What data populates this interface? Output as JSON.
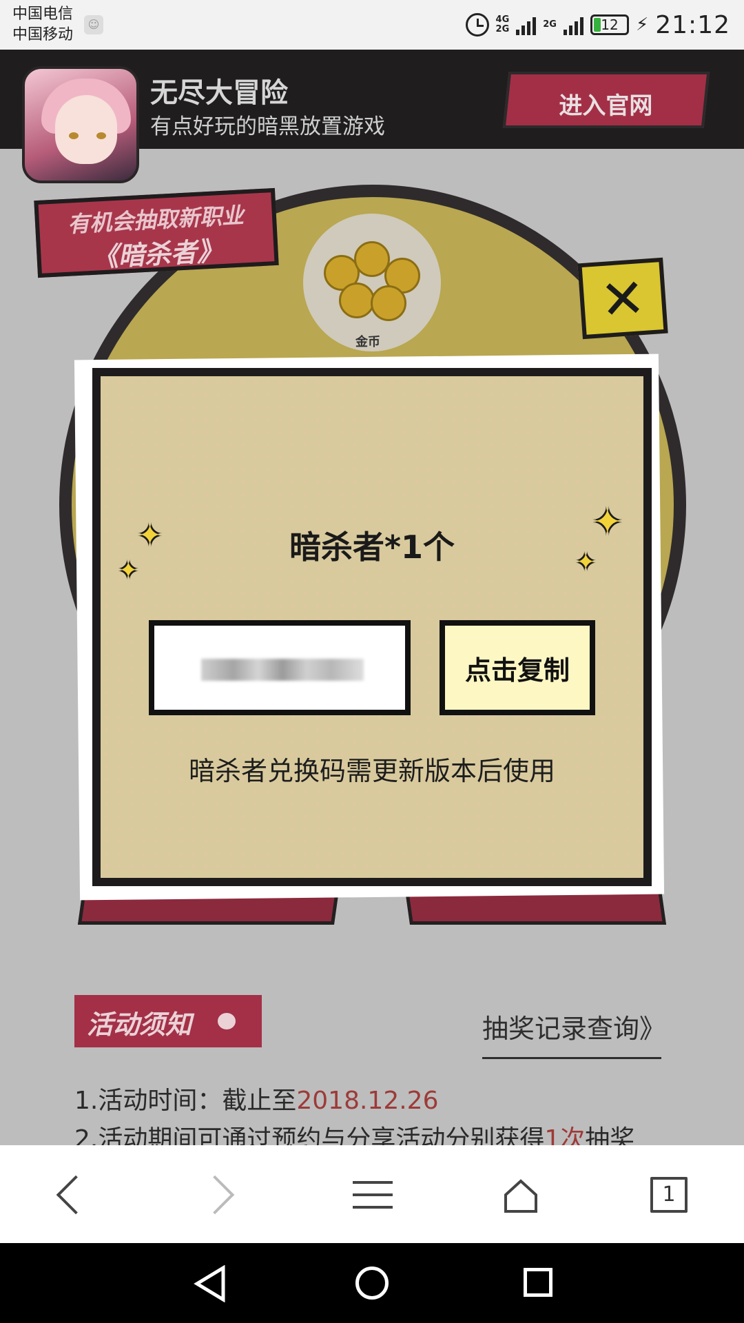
{
  "status_bar": {
    "carriers": [
      "中国电信",
      "中国移动"
    ],
    "network_tag_1": [
      "4G",
      "2G"
    ],
    "network_tag_2": "2G",
    "battery": "12",
    "time": "21:12"
  },
  "header": {
    "app_name": "无尽大冒险",
    "app_subtitle": "有点好玩的暗黑放置游戏",
    "official_site_button": "进入官网"
  },
  "background": {
    "chance_banner_line1": "有机会抽取新职业",
    "chance_banner_line2": "《暗杀者》",
    "coin_label": "金币",
    "notice_tag": "活动须知",
    "record_link": "抽奖记录查询》",
    "rules": {
      "rule1_prefix": "1.活动时间：截止至",
      "rule1_date": "2018.12.26",
      "rule2_prefix": "2.活动期间可通过预约与分享活动分别获得",
      "rule2_highlight": "1次",
      "rule2_suffix": "抽奖"
    }
  },
  "modal": {
    "prize_title": "暗杀者*1个",
    "copy_button": "点击复制",
    "tip": "暗杀者兑换码需更新版本后使用",
    "close_symbol": "✕"
  },
  "browser_toolbar": {
    "tab_count": "1"
  },
  "colors": {
    "header_bg": "#1f1d1e",
    "accent_red": "#a32f47",
    "modal_bg": "#d8ca9d",
    "copy_button_bg": "#fdf7c3",
    "highlight_text": "#9d3a38"
  },
  "icons": [
    "alarm-icon",
    "signal-icon",
    "battery-icon",
    "charging-icon",
    "close-icon",
    "sparkle-icon",
    "back-icon",
    "forward-icon",
    "menu-icon",
    "home-icon",
    "tabs-icon",
    "nav-back-icon",
    "nav-home-icon",
    "nav-recent-icon"
  ]
}
